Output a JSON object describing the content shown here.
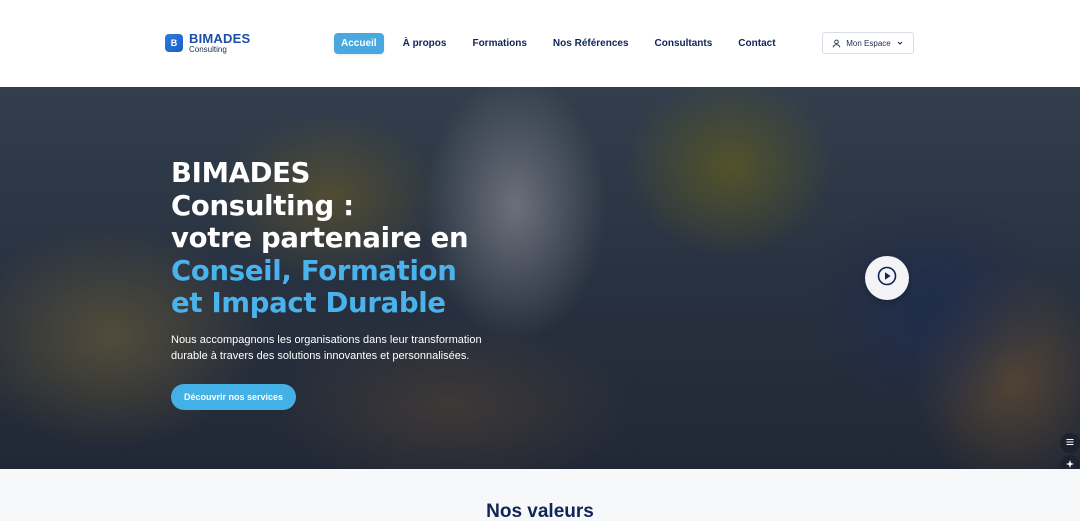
{
  "brand": {
    "badge": "B",
    "name": "BIMADES",
    "subtitle": "Consulting",
    "color": "#1b4fa8"
  },
  "nav": {
    "items": [
      {
        "label": "Accueil",
        "active": true
      },
      {
        "label": "À propos",
        "active": false
      },
      {
        "label": "Formations",
        "active": false
      },
      {
        "label": "Nos Références",
        "active": false
      },
      {
        "label": "Consultants",
        "active": false
      },
      {
        "label": "Contact",
        "active": false
      }
    ],
    "account_button": "Mon Espace",
    "account_icon": "user-icon",
    "dropdown_icon": "chevron-down-icon"
  },
  "hero": {
    "title_line1": "BIMADES",
    "title_line2": "Consulting :",
    "title_line3": "votre partenaire en",
    "title_accent_line1": "Conseil, Formation",
    "title_accent_line2": "et Impact Durable",
    "description": "Nous accompagnons les organisations dans leur transformation durable à travers des solutions innovantes et personnalisées.",
    "cta_label": "Découvrir nos services",
    "play_icon": "play-icon",
    "accent_color": "#4ab3ec"
  },
  "widgets": {
    "icons": [
      "list-icon",
      "sparkle-icon",
      "translate-icon",
      "chat-icon"
    ]
  },
  "values": {
    "title": "Nos valeurs"
  }
}
